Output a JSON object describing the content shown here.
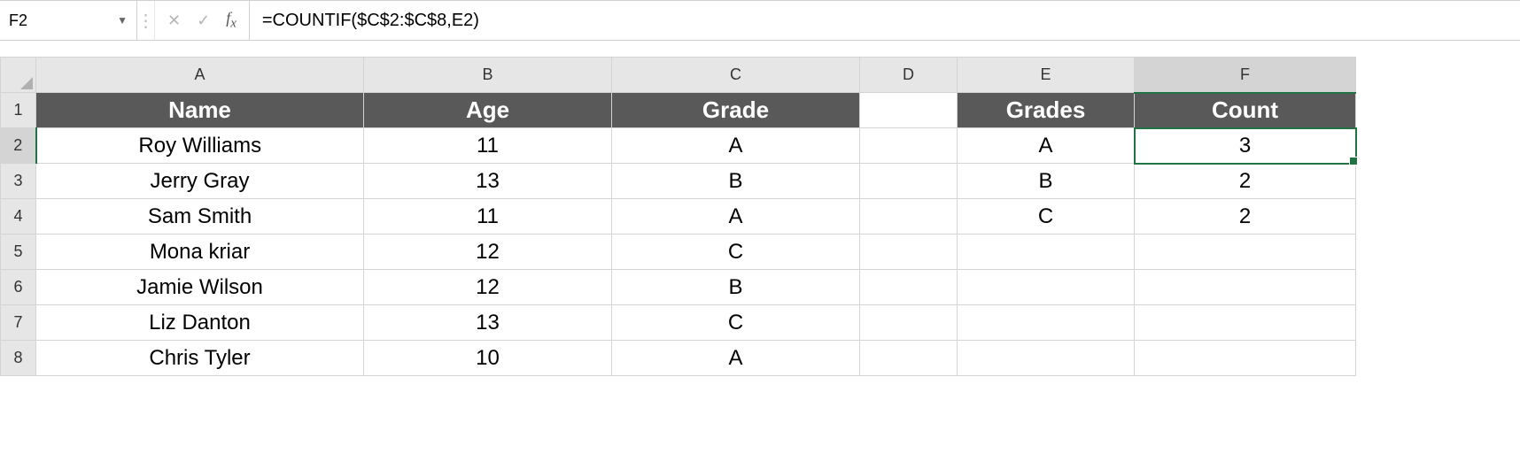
{
  "name_box": "F2",
  "formula": "=COUNTIF($C$2:$C$8,E2)",
  "columns": [
    "A",
    "B",
    "C",
    "D",
    "E",
    "F"
  ],
  "row_numbers": [
    "1",
    "2",
    "3",
    "4",
    "5",
    "6",
    "7",
    "8"
  ],
  "header_row": {
    "A": "Name",
    "B": "Age",
    "C": "Grade",
    "D": "",
    "E": "Grades",
    "F": "Count"
  },
  "rows": [
    {
      "A": "Roy Williams",
      "B": "11",
      "C": "A",
      "D": "",
      "E": "A",
      "F": "3"
    },
    {
      "A": "Jerry Gray",
      "B": "13",
      "C": "B",
      "D": "",
      "E": "B",
      "F": "2"
    },
    {
      "A": "Sam Smith",
      "B": "11",
      "C": "A",
      "D": "",
      "E": "C",
      "F": "2"
    },
    {
      "A": "Mona kriar",
      "B": "12",
      "C": "C",
      "D": "",
      "E": "",
      "F": ""
    },
    {
      "A": "Jamie Wilson",
      "B": "12",
      "C": "B",
      "D": "",
      "E": "",
      "F": ""
    },
    {
      "A": "Liz Danton",
      "B": "13",
      "C": "C",
      "D": "",
      "E": "",
      "F": ""
    },
    {
      "A": "Chris Tyler",
      "B": "10",
      "C": "A",
      "D": "",
      "E": "",
      "F": ""
    }
  ],
  "selected_cell": "F2"
}
